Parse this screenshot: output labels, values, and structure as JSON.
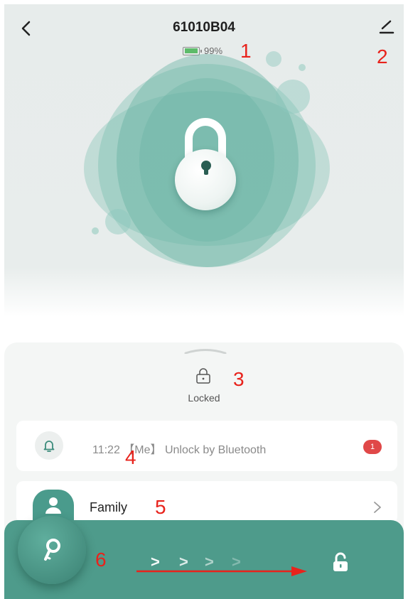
{
  "header": {
    "title": "61010B04",
    "battery_percent": "99%"
  },
  "annotations": {
    "a1": "1",
    "a2": "2",
    "a3": "3",
    "a4": "4",
    "a5": "5",
    "a6": "6"
  },
  "status": {
    "text": "Locked"
  },
  "event": {
    "text": "11:22 【Me】 Unlock by Bluetooth",
    "badge": "1"
  },
  "family": {
    "label": "Family"
  },
  "slider": {
    "chevrons": [
      ">",
      ">",
      ">",
      ">"
    ]
  },
  "colors": {
    "accent": "#4e9b8b",
    "badge": "#e04848",
    "annotation": "#e8231c"
  },
  "icons": [
    "back-icon",
    "edit-icon",
    "battery-icon",
    "padlock-icon",
    "lock-status-icon",
    "bell-icon",
    "person-icon",
    "chevron-right-icon",
    "key-icon",
    "unlock-icon"
  ]
}
